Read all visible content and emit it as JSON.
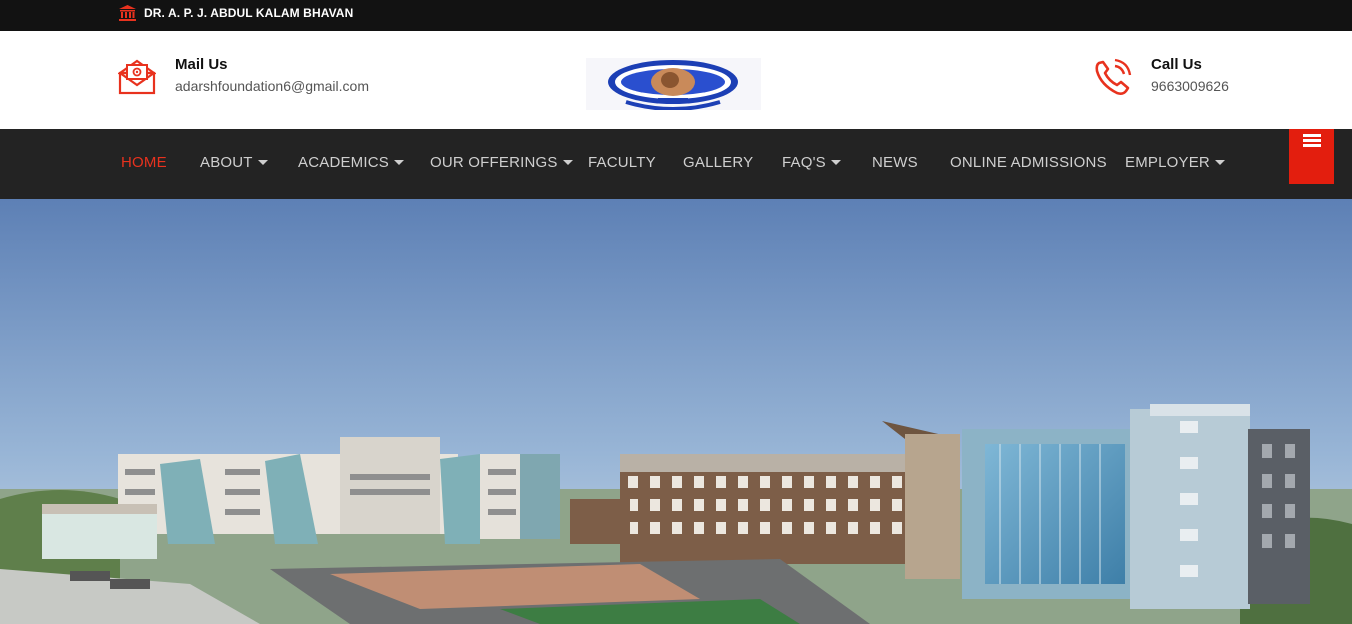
{
  "topbar": {
    "text": "DR. A. P. J. ABDUL KALAM BHAVAN",
    "icon": "bank-icon"
  },
  "header": {
    "mail": {
      "title": "Mail Us",
      "value": "adarshfoundation6@gmail.com",
      "icon": "mail-icon"
    },
    "call": {
      "title": "Call Us",
      "value": "9663009626",
      "icon": "phone-icon"
    },
    "logo": "institution-logo"
  },
  "nav": {
    "items": [
      {
        "label": "HOME",
        "active": true,
        "dropdown": false
      },
      {
        "label": "ABOUT",
        "active": false,
        "dropdown": true
      },
      {
        "label": "ACADEMICS",
        "active": false,
        "dropdown": true
      },
      {
        "label": "OUR OFFERINGS",
        "active": false,
        "dropdown": true
      },
      {
        "label": "FACULTY",
        "active": false,
        "dropdown": false
      },
      {
        "label": "GALLERY",
        "active": false,
        "dropdown": false
      },
      {
        "label": "FAQ'S",
        "active": false,
        "dropdown": true
      },
      {
        "label": "NEWS",
        "active": false,
        "dropdown": false
      },
      {
        "label": "ONLINE ADMISSIONS",
        "active": false,
        "dropdown": false
      },
      {
        "label": "EMPLOYER",
        "active": false,
        "dropdown": true
      }
    ],
    "menu_icon": "hamburger-icon"
  },
  "colors": {
    "accent": "#e31e0e",
    "navbar": "#232323",
    "topbar": "#121212"
  }
}
